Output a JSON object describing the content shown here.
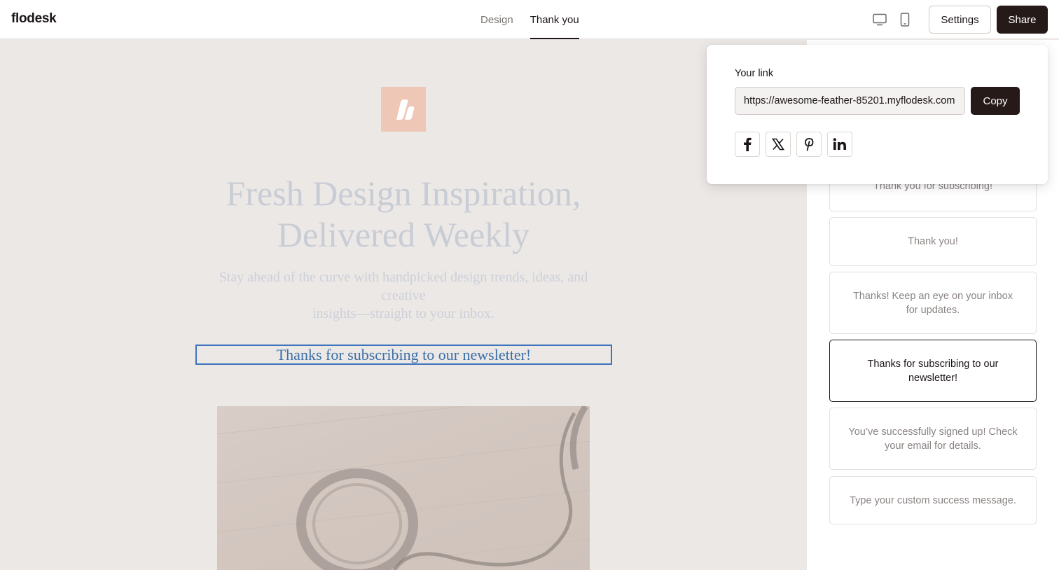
{
  "app": {
    "logo": "flodesk"
  },
  "header": {
    "tabs": [
      {
        "label": "Design",
        "active": false
      },
      {
        "label": "Thank you",
        "active": true
      }
    ],
    "device_icons": [
      "desktop-icon",
      "mobile-icon"
    ],
    "settings_label": "Settings",
    "share_label": "Share"
  },
  "canvas": {
    "headline_line1": "Fresh Design Inspiration,",
    "headline_line2": "Delivered Weekly",
    "subhead_line1": "Stay ahead of the curve with handpicked design trends, ideas, and creative",
    "subhead_line2": "insights—straight to your inbox.",
    "success_message": "Thanks for subscribing to our newsletter!"
  },
  "share_popover": {
    "label": "Your link",
    "link_value": "https://awesome-feather-85201.myflodesk.com",
    "copy_label": "Copy",
    "social_icons": [
      "facebook-icon",
      "x-icon",
      "pinterest-icon",
      "linkedin-icon"
    ]
  },
  "messages_panel": {
    "options": [
      {
        "text": "Thank you for subscribing!",
        "selected": false
      },
      {
        "text": "Thank you!",
        "selected": false
      },
      {
        "text": "Thanks! Keep an eye on your inbox for updates.",
        "selected": false
      },
      {
        "text": "Thanks for subscribing to our newsletter!",
        "selected": true
      },
      {
        "text": "You’ve successfully signed up! Check your email for details.",
        "selected": false
      },
      {
        "text": "Type your custom success message.",
        "selected": false
      }
    ]
  },
  "colors": {
    "accent_dark": "#251a18",
    "selection_blue": "#3f73bc",
    "brand_mark": "#efc7b7"
  }
}
